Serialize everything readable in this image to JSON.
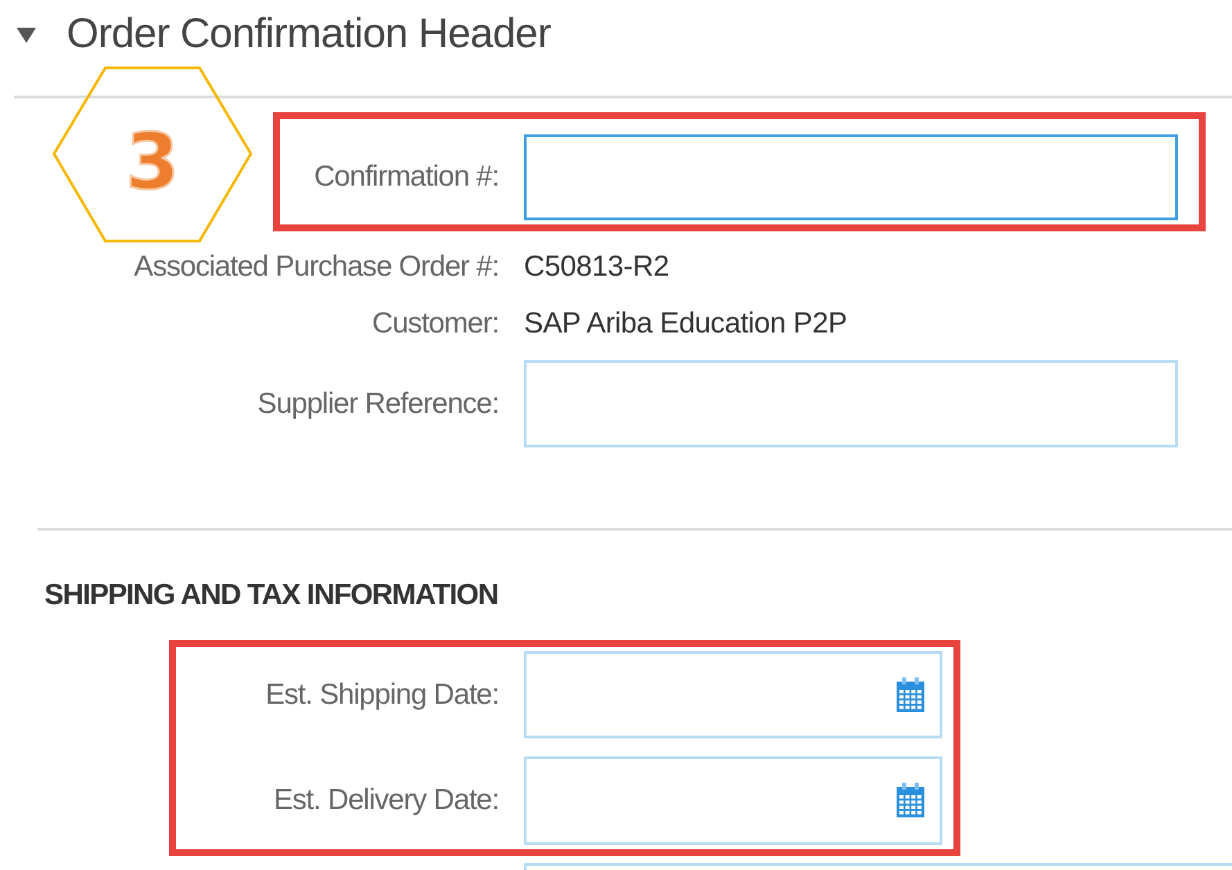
{
  "section": {
    "title": "Order Confirmation Header",
    "expanded": true
  },
  "step_badge": {
    "number": "3"
  },
  "header_rows": [
    {
      "kind": "input",
      "label": "Confirmation #:",
      "focused": true,
      "highlighted": true
    },
    {
      "kind": "text",
      "label": "Associated Purchase Order #:",
      "value": "C50813-R2",
      "highlighted": false
    },
    {
      "kind": "text",
      "label": "Customer:",
      "value": "SAP Ariba Education P2P",
      "highlighted": false
    },
    {
      "kind": "input",
      "label": "Supplier Reference:",
      "focused": false,
      "highlighted": false
    }
  ],
  "shipping": {
    "heading": "SHIPPING AND TAX INFORMATION",
    "rows": [
      {
        "kind": "date",
        "label": "Est. Shipping Date:",
        "focused": false,
        "highlighted": true
      },
      {
        "kind": "date",
        "label": "Est. Delivery Date:",
        "focused": false,
        "highlighted": true
      },
      {
        "kind": "input",
        "focused": false,
        "highlighted": false
      }
    ]
  }
}
